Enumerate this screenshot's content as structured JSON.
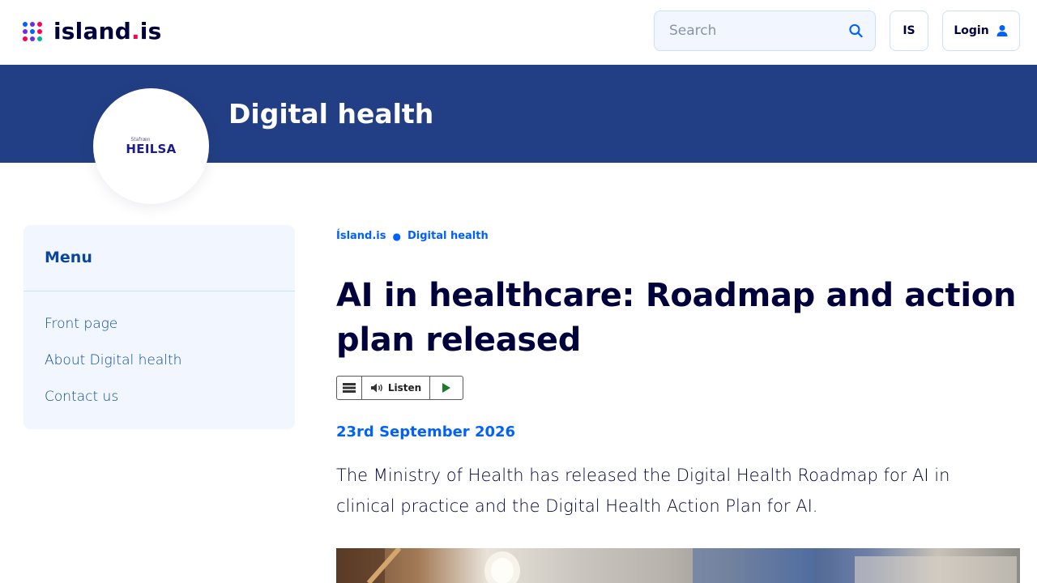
{
  "header": {
    "logo_text": "island",
    "logo_dot": ".",
    "logo_suffix": "is",
    "search_placeholder": "Search",
    "language_label": "IS",
    "login_label": "Login",
    "logo_dot_colors": [
      "#0061ff",
      "#6a2ee8",
      "#ff0050",
      "#6a2ee8",
      "#0061ff",
      "#ff0050",
      "#ff0050",
      "#6a2ee8",
      "#00b39e"
    ]
  },
  "banner": {
    "title": "Digital health",
    "org_logo_small": "Stafræn",
    "org_logo_big": "HEILSA"
  },
  "sidebar": {
    "title": "Menu",
    "items": [
      {
        "label": "Front page"
      },
      {
        "label": "About Digital health"
      },
      {
        "label": "Contact us"
      }
    ]
  },
  "breadcrumb": [
    {
      "label": "Ísland.is"
    },
    {
      "label": "Digital health"
    }
  ],
  "article": {
    "title": "AI in healthcare: Roadmap and action plan released",
    "listen_label": "Listen",
    "date": "23rd September 2026",
    "intro": "The Ministry of Health has released the Digital Health Roadmap for AI in clinical practice and the Digital Health Action Plan for AI."
  },
  "colors": {
    "banner_bg": "#223f85",
    "link_blue": "#0061ff",
    "text_dark": "#00003c",
    "menu_bg": "#f2f7ff"
  }
}
